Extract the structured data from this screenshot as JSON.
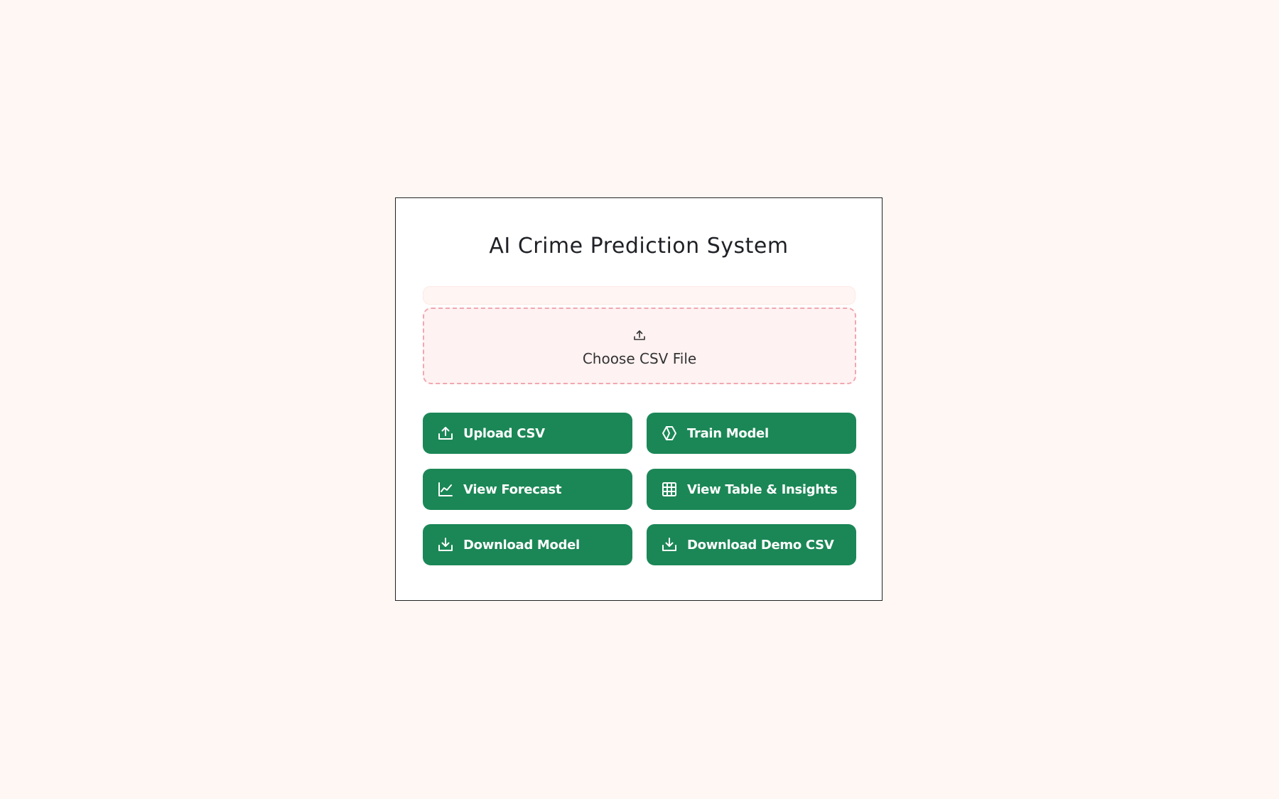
{
  "app": {
    "title": "AI Crime Prediction System"
  },
  "file_picker": {
    "label": "Choose CSV File",
    "icon": "upload-icon"
  },
  "buttons": [
    {
      "label": "Upload CSV",
      "icon": "upload-icon"
    },
    {
      "label": "Train Model",
      "icon": "hexagon-icon"
    },
    {
      "label": "View Forecast",
      "icon": "line-chart-icon"
    },
    {
      "label": "View Table & Insights",
      "icon": "table-grid-icon"
    },
    {
      "label": "Download Model",
      "icon": "download-icon"
    },
    {
      "label": "Download Demo CSV",
      "icon": "download-icon"
    }
  ],
  "colors": {
    "background": "#fff7f3",
    "card": "#ffffff",
    "button": "#1b8756",
    "button_text": "#ffffff",
    "dropzone_bg": "#fff2f2",
    "dropzone_border": "#f0a8b0"
  }
}
